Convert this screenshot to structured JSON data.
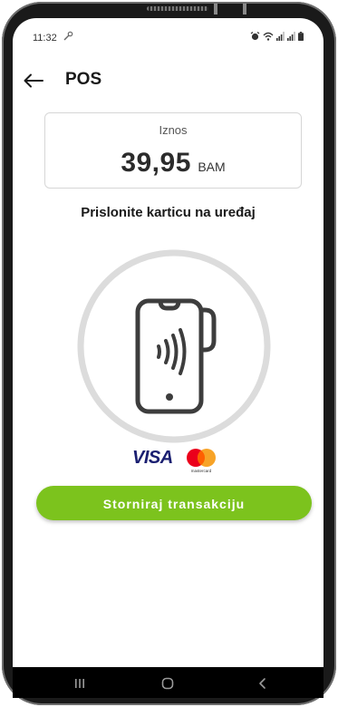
{
  "status_bar": {
    "time": "11:32",
    "left_icon": "wrench-icon",
    "right_icons": [
      "alarm-icon",
      "wifi-icon",
      "signal-icon",
      "signal-icon",
      "battery-icon"
    ]
  },
  "header": {
    "back_icon": "arrow-left-icon",
    "title": "POS"
  },
  "amount": {
    "label": "Iznos",
    "value": "39,95",
    "currency": "BAM"
  },
  "instruction": "Prislonite karticu na uređaj",
  "nfc_graphic": {
    "icon": "phone-contactless-icon"
  },
  "card_logos": {
    "visa": "VISA",
    "mastercard_caption": "mastercard"
  },
  "actions": {
    "void_label": "Storniraj transakciju"
  },
  "colors": {
    "accent": "#7cc31d",
    "icon_gray": "#3d3d3d",
    "ring_gray": "#dcdcdc",
    "visa_blue": "#1a1f71",
    "mastercard_red": "#eb001b",
    "mastercard_yellow": "#f79e1b"
  },
  "nav_bar": {
    "buttons": [
      "recent-apps-icon",
      "home-icon",
      "back-icon"
    ]
  }
}
